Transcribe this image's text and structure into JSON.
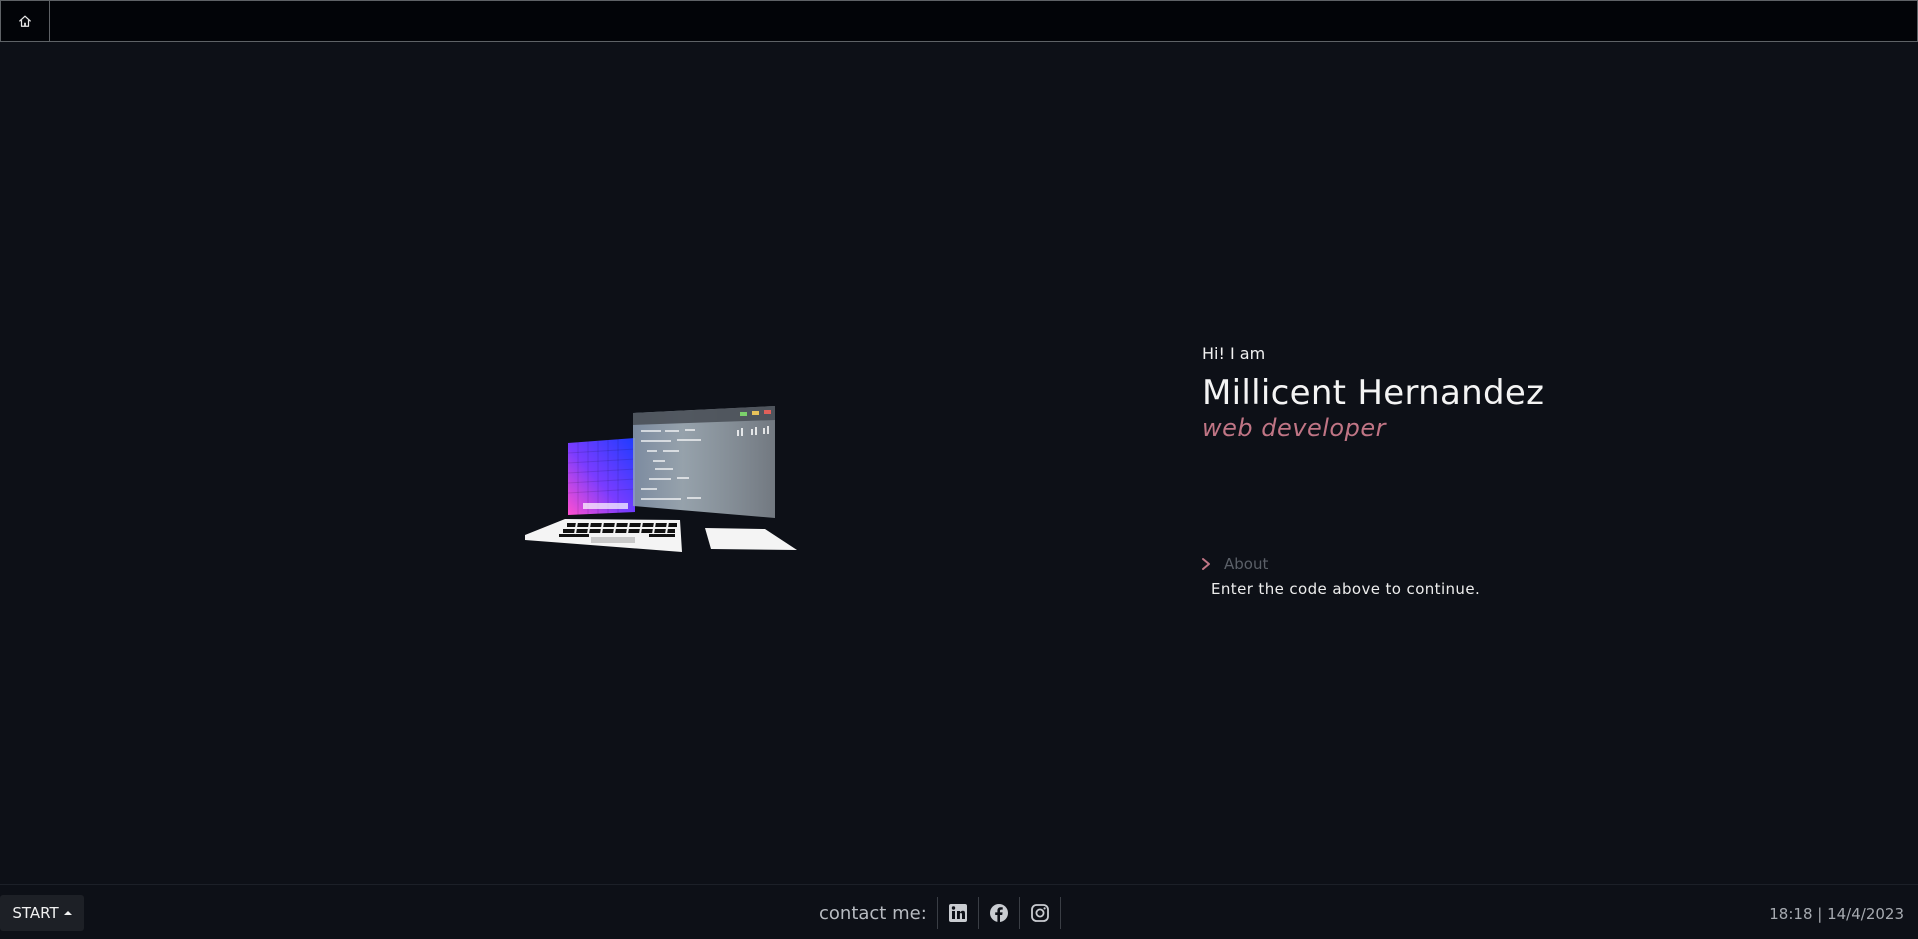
{
  "header": {
    "home_icon": "home-icon"
  },
  "intro": {
    "greeting": "Hi! I am",
    "name": "Millicent Hernandez",
    "role": "web developer"
  },
  "menu": {
    "about_label": "About",
    "hint": "Enter the code above to continue."
  },
  "taskbar": {
    "start_label": "START",
    "contact_label": "contact me:",
    "socials": [
      {
        "name": "linkedin",
        "icon": "linkedin-icon"
      },
      {
        "name": "facebook",
        "icon": "facebook-icon"
      },
      {
        "name": "instagram",
        "icon": "instagram-icon"
      }
    ],
    "clock": "18:18 | 14/4/2023"
  },
  "colors": {
    "background": "#0d1017",
    "accent": "#c07585",
    "topbar": "#020408"
  }
}
